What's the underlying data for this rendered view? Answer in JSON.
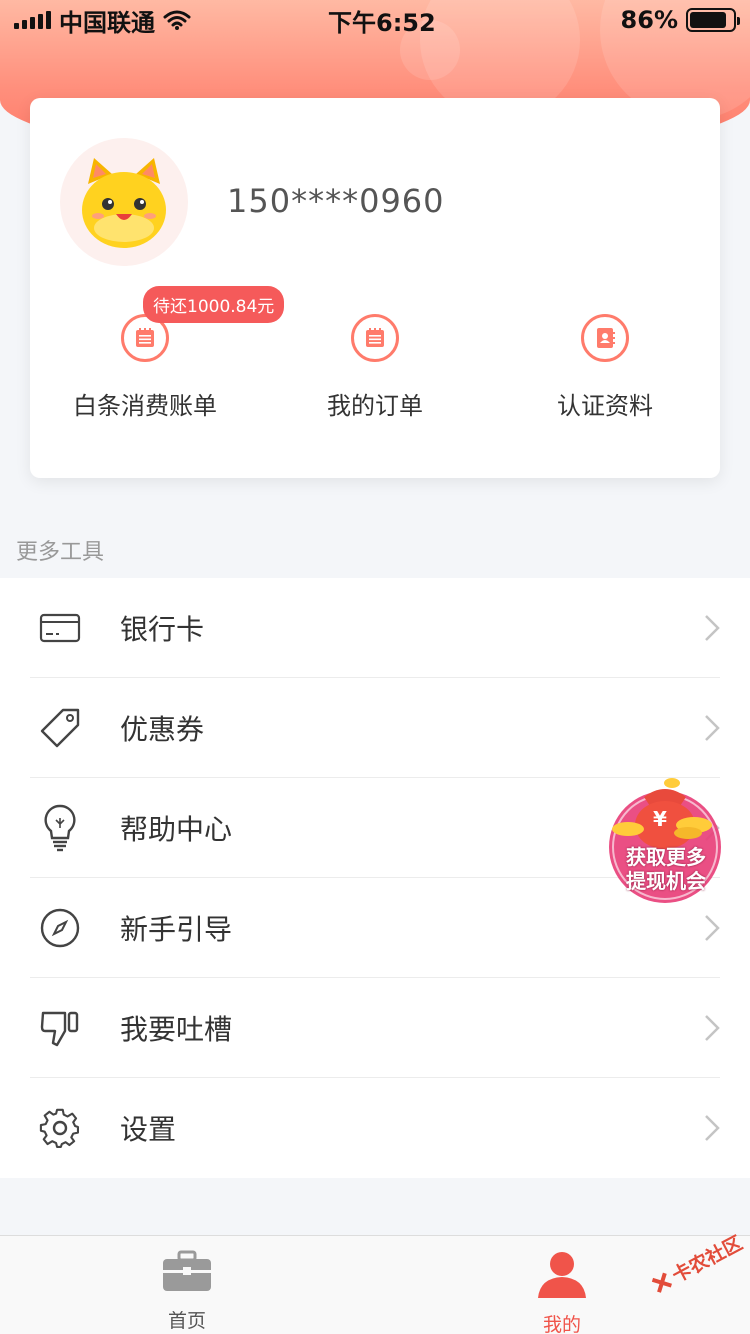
{
  "status_bar": {
    "carrier": "中国联通",
    "time": "下午6:52",
    "battery": "86%"
  },
  "profile": {
    "phone": "150****0960"
  },
  "quick_actions": [
    {
      "label": "白条消费账单",
      "badge": "待还1000.84元",
      "icon": "bill-icon"
    },
    {
      "label": "我的订单",
      "icon": "order-icon"
    },
    {
      "label": "认证资料",
      "icon": "contacts-book-icon"
    }
  ],
  "section": {
    "title": "更多工具"
  },
  "menu": [
    {
      "label": "银行卡",
      "icon": "bank-card-icon"
    },
    {
      "label": "优惠券",
      "icon": "tag-icon"
    },
    {
      "label": "帮助中心",
      "icon": "lightbulb-icon"
    },
    {
      "label": "新手引导",
      "icon": "compass-icon"
    },
    {
      "label": "我要吐槽",
      "icon": "thumbs-down-icon"
    },
    {
      "label": "设置",
      "icon": "gear-icon"
    }
  ],
  "promo": {
    "line1": "获取更多",
    "line2": "提现机会",
    "currency": "¥"
  },
  "tabbar": [
    {
      "label": "首页",
      "icon": "briefcase-icon",
      "active": false
    },
    {
      "label": "我的",
      "icon": "person-icon",
      "active": true
    }
  ],
  "watermark": {
    "text": "卡农社区"
  },
  "colors": {
    "accent": "#ff7b6b",
    "badge": "#f55a5a",
    "active_tab": "#f0544a"
  }
}
